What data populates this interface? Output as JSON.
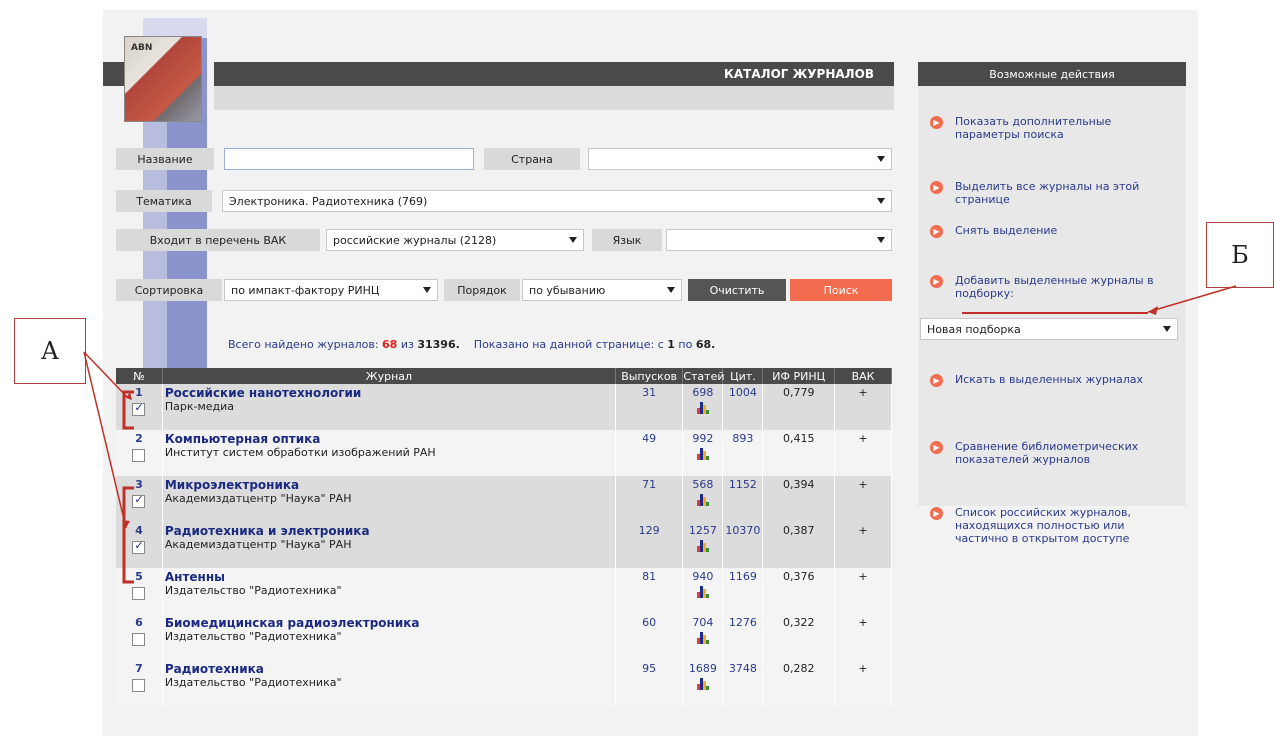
{
  "catalog": {
    "title": "КАТАЛОГ ЖУРНАЛОВ",
    "logo_text": "ABN"
  },
  "search": {
    "name_label": "Название",
    "name_value": "",
    "country_label": "Страна",
    "country_value": "",
    "topic_label": "Тематика",
    "topic_value": "Электроника. Радиотехника  (769)",
    "vak_label": "Входит в перечень ВАК",
    "vak_value": "российские журналы  (2128)",
    "lang_label": "Язык",
    "lang_value": "",
    "sort_label": "Сортировка",
    "sort_value": "по импакт-фактору РИНЦ",
    "order_label": "Порядок",
    "order_value": "по убыванию",
    "clear_button": "Очистить",
    "search_button": "Поиск"
  },
  "summary": {
    "found_prefix": "Всего найдено журналов:",
    "found": "68",
    "of": "из",
    "total": "31396.",
    "shown_prefix": "Показано на данной странице: с",
    "from": "1",
    "to_word": "по",
    "to": "68."
  },
  "table": {
    "headers": [
      "№",
      "Журнал",
      "Выпусков",
      "Статей",
      "Цит.",
      "ИФ РИНЦ",
      "ВАК"
    ],
    "rows": [
      {
        "num": "1",
        "name": "Российские нанотехнологии",
        "publisher": "Парк-медиа",
        "issues": "31",
        "articles": "698",
        "cit": "1004",
        "if": "0,779",
        "vak": "+",
        "checked": true
      },
      {
        "num": "2",
        "name": "Компьютерная оптика",
        "publisher": "Институт систем обработки изображений РАН",
        "issues": "49",
        "articles": "992",
        "cit": "893",
        "if": "0,415",
        "vak": "+",
        "checked": false
      },
      {
        "num": "3",
        "name": "Микроэлектроника",
        "publisher": "Академиздатцентр \"Наука\" РАН",
        "issues": "71",
        "articles": "568",
        "cit": "1152",
        "if": "0,394",
        "vak": "+",
        "checked": true
      },
      {
        "num": "4",
        "name": "Радиотехника и электроника",
        "publisher": "Академиздатцентр \"Наука\" РАН",
        "issues": "129",
        "articles": "1257",
        "cit": "10370",
        "if": "0,387",
        "vak": "+",
        "checked": true
      },
      {
        "num": "5",
        "name": "Антенны",
        "publisher": "Издательство \"Радиотехника\"",
        "issues": "81",
        "articles": "940",
        "cit": "1169",
        "if": "0,376",
        "vak": "+",
        "checked": false
      },
      {
        "num": "6",
        "name": "Биомедицинская радиоэлектроника",
        "publisher": "Издательство \"Радиотехника\"",
        "issues": "60",
        "articles": "704",
        "cit": "1276",
        "if": "0,322",
        "vak": "+",
        "checked": false
      },
      {
        "num": "7",
        "name": "Радиотехника",
        "publisher": "Издательство \"Радиотехника\"",
        "issues": "95",
        "articles": "1689",
        "cit": "3748",
        "if": "0,282",
        "vak": "+",
        "checked": false
      }
    ]
  },
  "actions": {
    "title": "Возможные действия",
    "show_params": "Показать дополнительные параметры поиска",
    "select_all": "Выделить все журналы на этой странице",
    "deselect": "Снять выделение",
    "add_selected": "Добавить выделенные журналы в подборку:",
    "collection_value": "Новая подборка",
    "search_in_selected": "Искать в выделенных журналах",
    "compare": "Сравнение библиометрических показателей журналов",
    "open_access": "Список российских журналов, находящихся полностью или частично в открытом доступе"
  },
  "callouts": {
    "a": "А",
    "b": "Б"
  },
  "colors": {
    "accent": "#f26c4f",
    "dark_bar": "#4a4a4a",
    "link": "#2a3a8c",
    "callout_line": "#c0302a"
  }
}
